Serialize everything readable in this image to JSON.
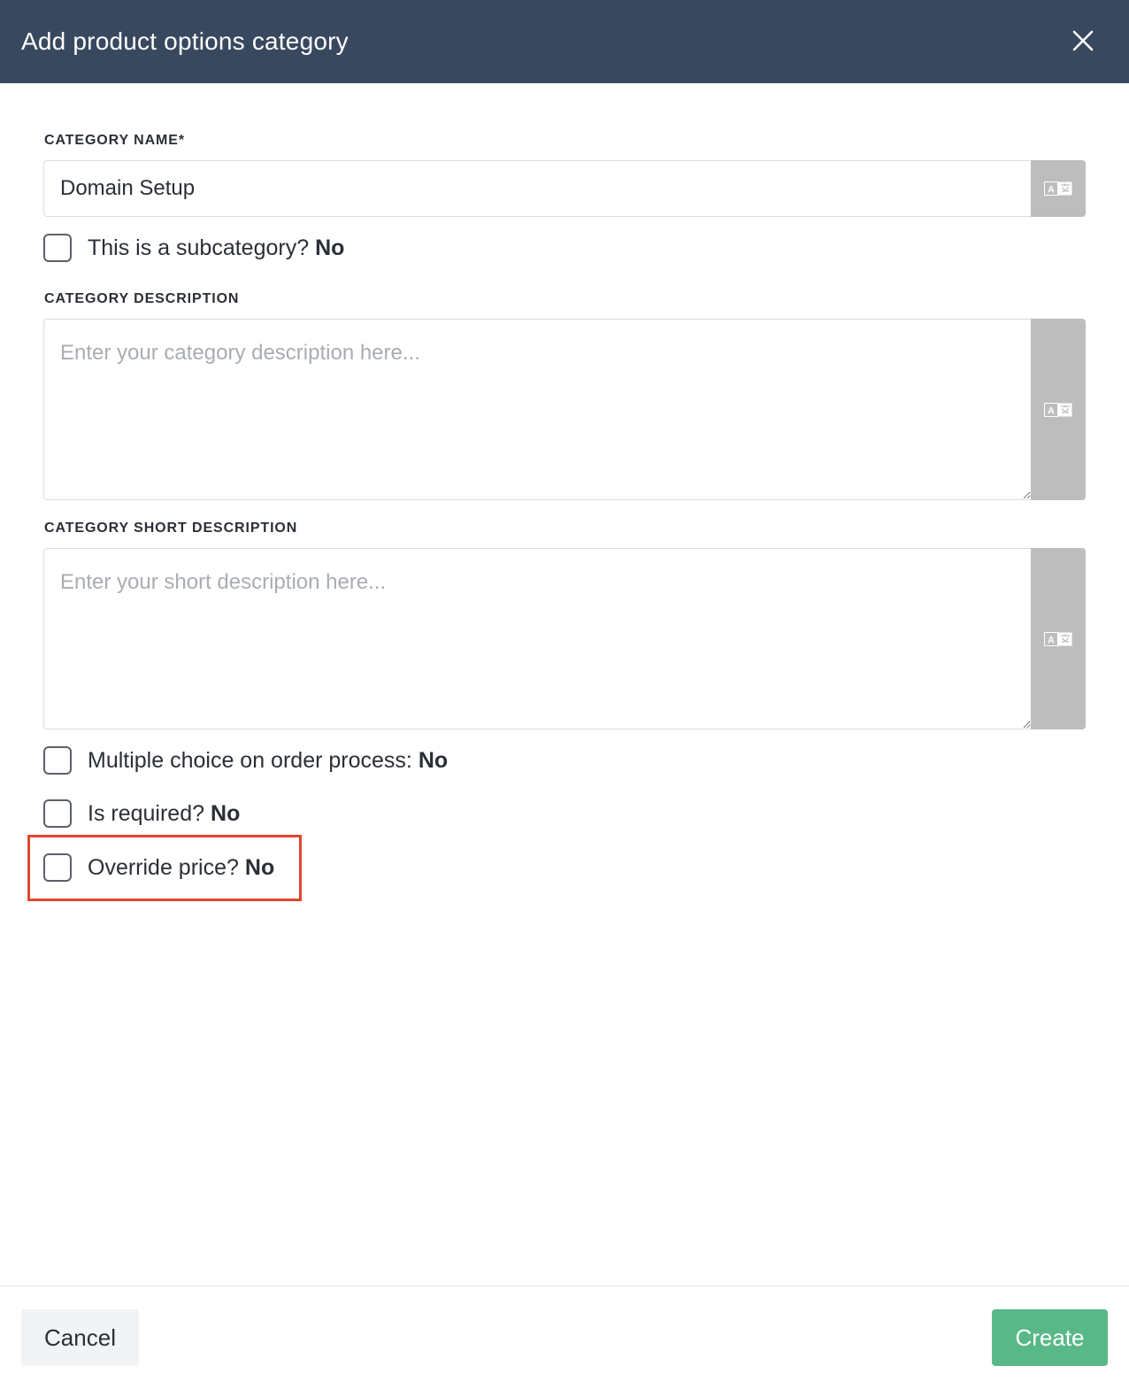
{
  "modal": {
    "title": "Add product options category"
  },
  "category_name": {
    "label": "CATEGORY NAME*",
    "value": "Domain Setup"
  },
  "subcategory": {
    "label": "This is a subcategory?",
    "value": "No",
    "checked": false
  },
  "category_description": {
    "label": "CATEGORY DESCRIPTION",
    "placeholder": "Enter your category description here...",
    "value": ""
  },
  "category_short_description": {
    "label": "CATEGORY SHORT DESCRIPTION",
    "placeholder": "Enter your short description here...",
    "value": ""
  },
  "multiple_choice": {
    "label": "Multiple choice on order process:",
    "value": "No",
    "checked": false
  },
  "is_required": {
    "label": "Is required?",
    "value": "No",
    "checked": false
  },
  "override_price": {
    "label": "Override price?",
    "value": "No",
    "checked": false
  },
  "footer": {
    "cancel_label": "Cancel",
    "create_label": "Create"
  },
  "colors": {
    "header_bg": "#38485f",
    "create_button": "#58b887",
    "highlight_border": "#e0472f",
    "translate_button": "#bdbdbd"
  },
  "icons": {
    "close": "close-icon",
    "translate": "translate-icon"
  }
}
